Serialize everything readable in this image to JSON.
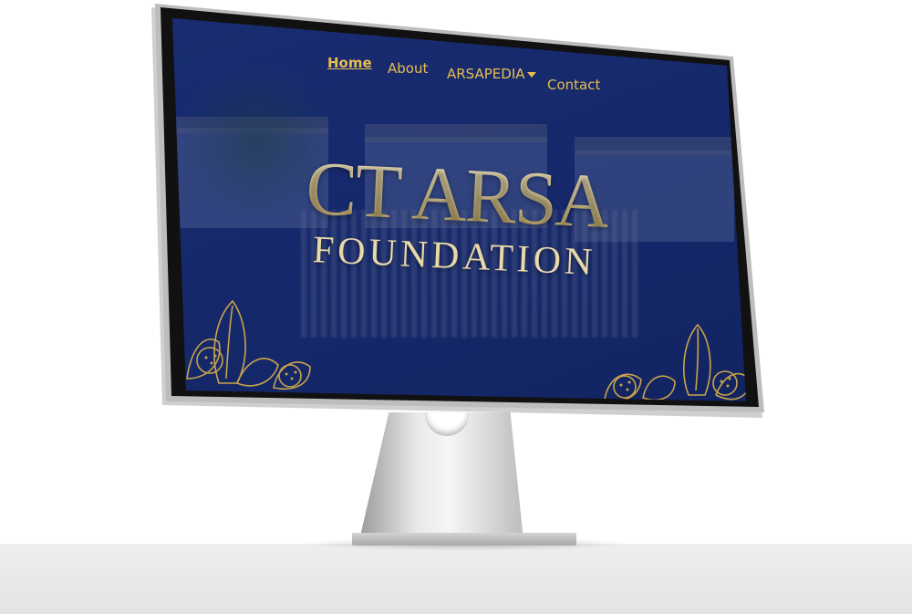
{
  "nav": {
    "items": [
      {
        "label": "Home",
        "active": true
      },
      {
        "label": "About",
        "active": false
      },
      {
        "label": "ARSAPEDIA",
        "active": false,
        "has_dropdown": true
      },
      {
        "label": "Contact",
        "active": false
      }
    ]
  },
  "hero": {
    "title": "CT ARSA",
    "subtitle": "FOUNDATION"
  },
  "colors": {
    "background": "#15286a",
    "accent_gold": "#e7bd4f",
    "title_cream": "#efe2b8"
  },
  "icons": {
    "decor_left": "floral-ornament-icon",
    "decor_right": "floral-ornament-icon",
    "dropdown": "caret-down-icon"
  }
}
